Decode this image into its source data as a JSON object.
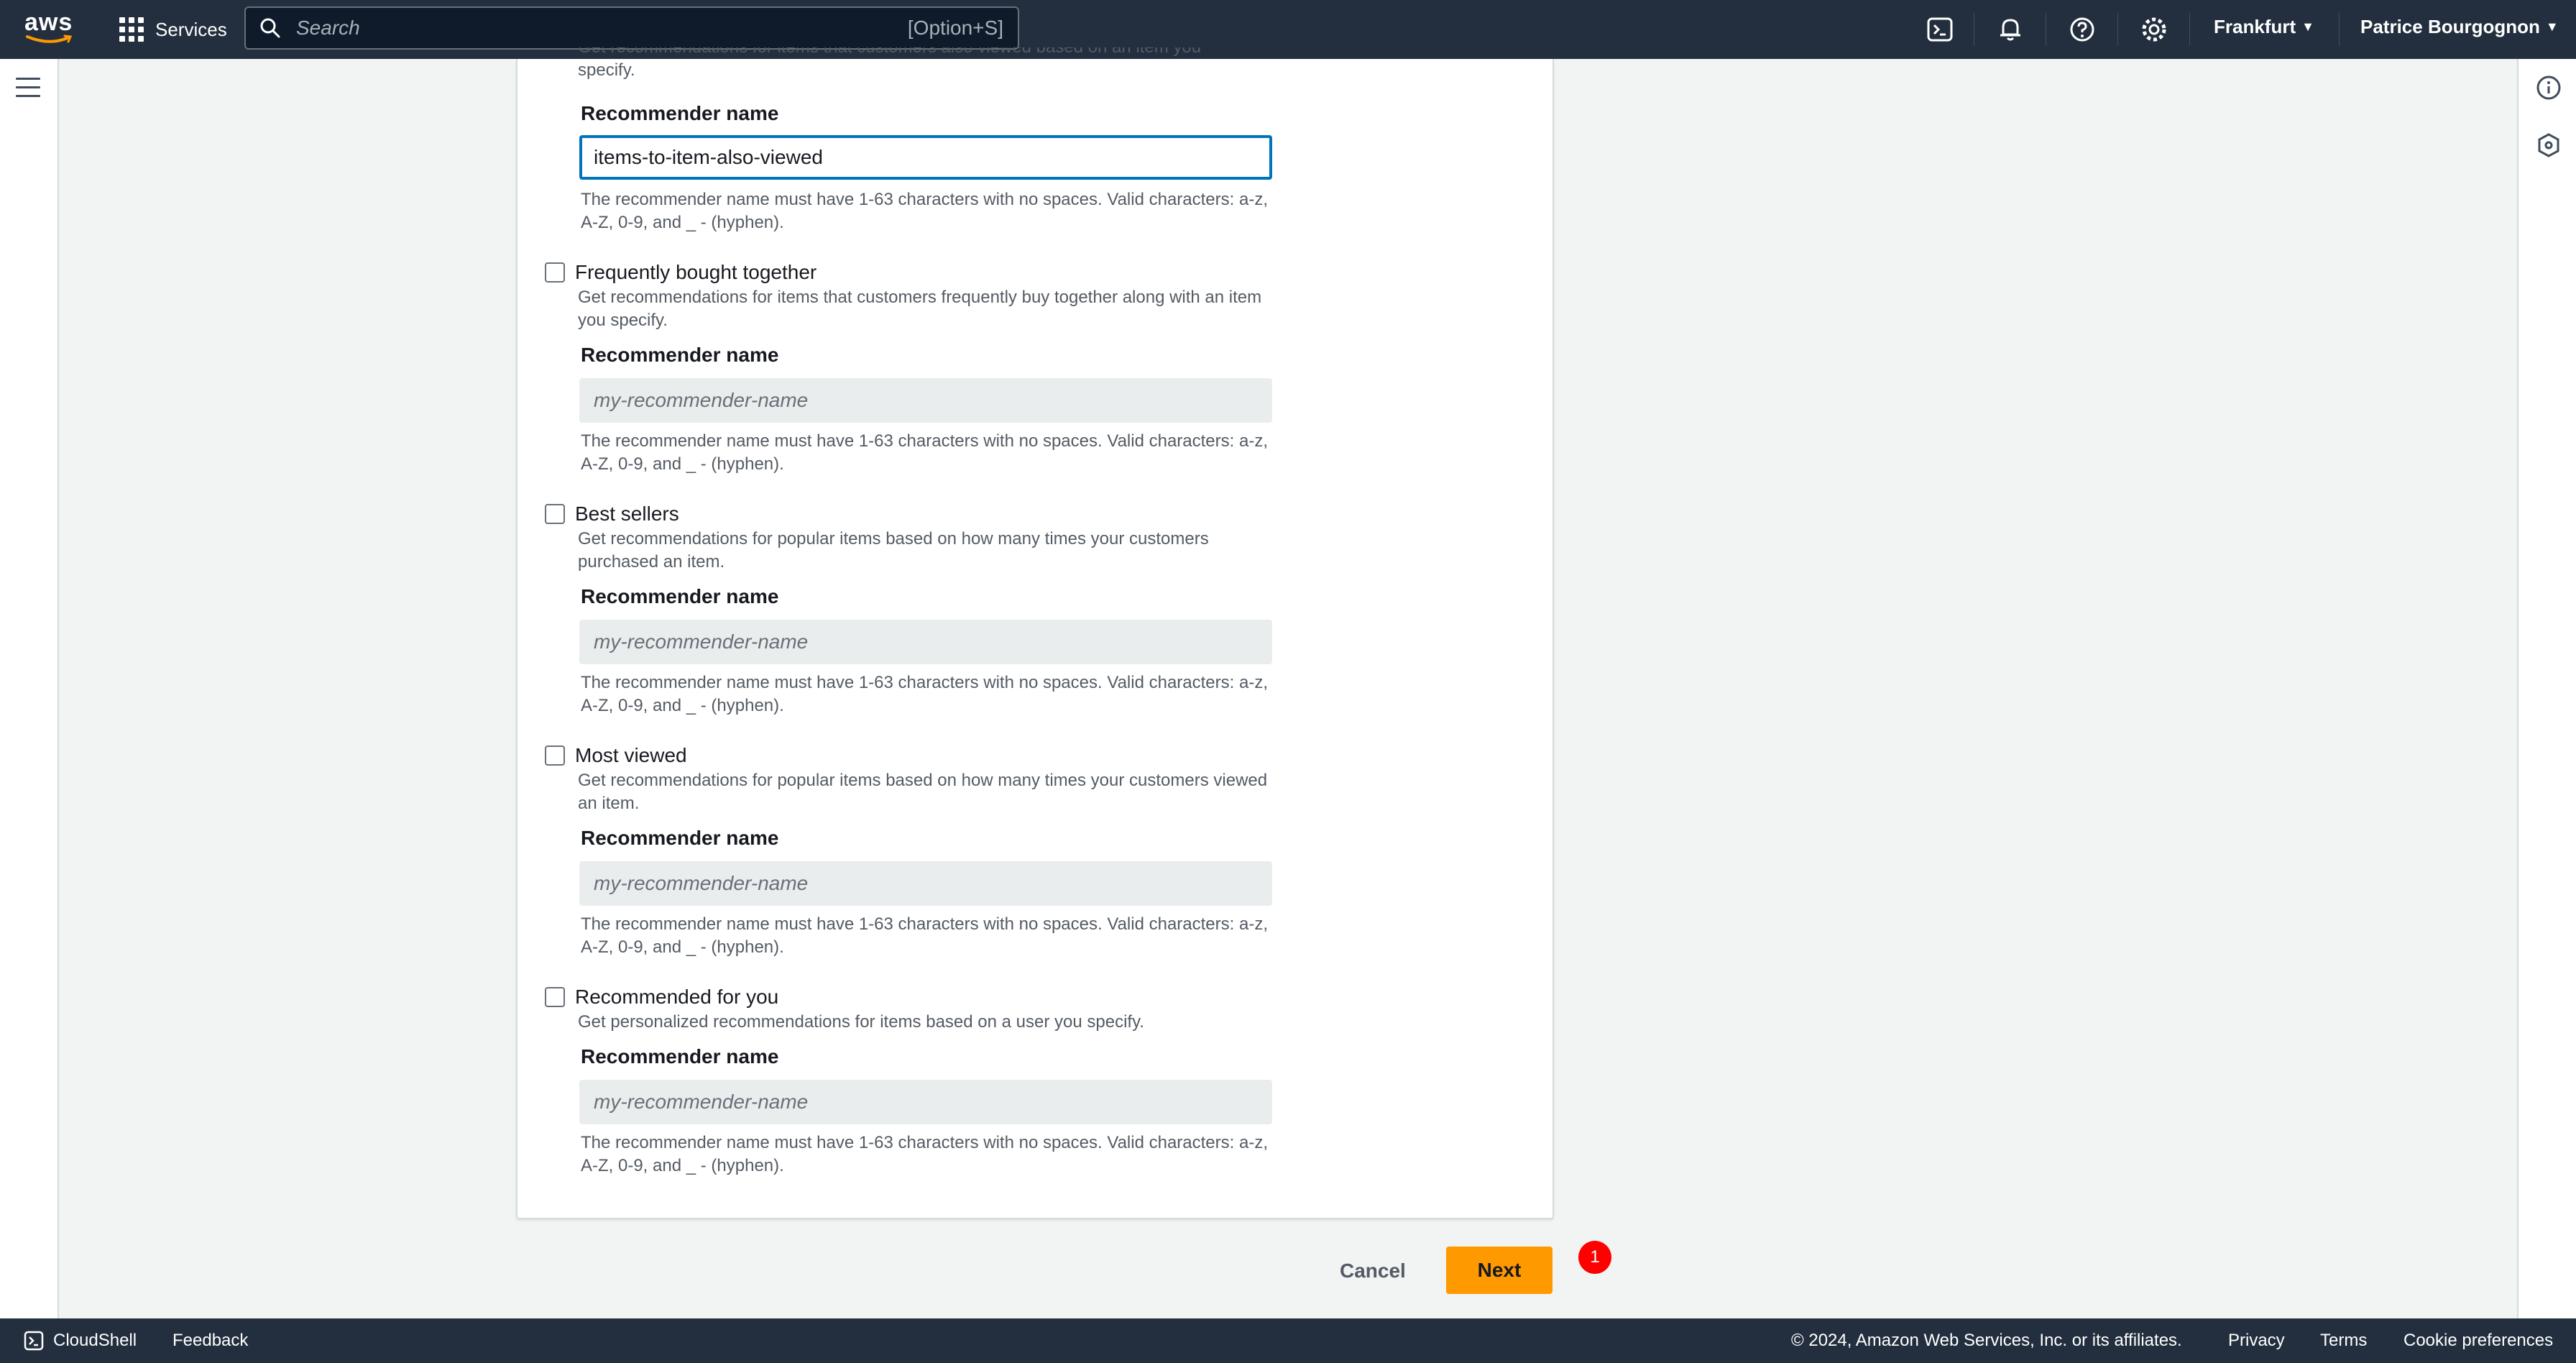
{
  "topnav": {
    "logo_text": "aws",
    "services_label": "Services",
    "search_placeholder": "Search",
    "search_shortcut": "[Option+S]",
    "region": "Frankfurt",
    "user": "Patrice Bourgognon",
    "icons": [
      "cloudshell-icon",
      "bell-icon",
      "help-icon",
      "settings-icon"
    ]
  },
  "form": {
    "top_option": {
      "description": "Get recommendations for items that customers also viewed based on an item you specify.",
      "field_label": "Recommender name",
      "value": "items-to-item-also-viewed",
      "hint": "The recommender name must have 1-63 characters with no spaces. Valid characters: a-z, A-Z, 0-9, and _ - (hyphen)."
    },
    "options": [
      {
        "title": "Frequently bought together",
        "description": "Get recommendations for items that customers frequently buy together along with an item you specify.",
        "field_label": "Recommender name",
        "placeholder": "my-recommender-name",
        "hint": "The recommender name must have 1-63 characters with no spaces. Valid characters: a-z, A-Z, 0-9, and _ - (hyphen)."
      },
      {
        "title": "Best sellers",
        "description": "Get recommendations for popular items based on how many times your customers purchased an item.",
        "field_label": "Recommender name",
        "placeholder": "my-recommender-name",
        "hint": "The recommender name must have 1-63 characters with no spaces. Valid characters: a-z, A-Z, 0-9, and _ - (hyphen)."
      },
      {
        "title": "Most viewed",
        "description": "Get recommendations for popular items based on how many times your customers viewed an item.",
        "field_label": "Recommender name",
        "placeholder": "my-recommender-name",
        "hint": "The recommender name must have 1-63 characters with no spaces. Valid characters: a-z, A-Z, 0-9, and _ - (hyphen)."
      },
      {
        "title": "Recommended for you",
        "description": "Get personalized recommendations for items based on a user you specify.",
        "field_label": "Recommender name",
        "placeholder": "my-recommender-name",
        "hint": "The recommender name must have 1-63 characters with no spaces. Valid characters: a-z, A-Z, 0-9, and _ - (hyphen)."
      }
    ]
  },
  "actions": {
    "cancel_label": "Cancel",
    "next_label": "Next",
    "badge_count": "1"
  },
  "bottombar": {
    "cloudshell_label": "CloudShell",
    "feedback_label": "Feedback",
    "copyright": "© 2024, Amazon Web Services, Inc. or its affiliates.",
    "privacy": "Privacy",
    "terms": "Terms",
    "cookie": "Cookie preferences"
  },
  "colors": {
    "nav_bg": "#232f3e",
    "primary_button": "#ff9900",
    "focus_border": "#0073bb",
    "badge": "#ff0000"
  }
}
